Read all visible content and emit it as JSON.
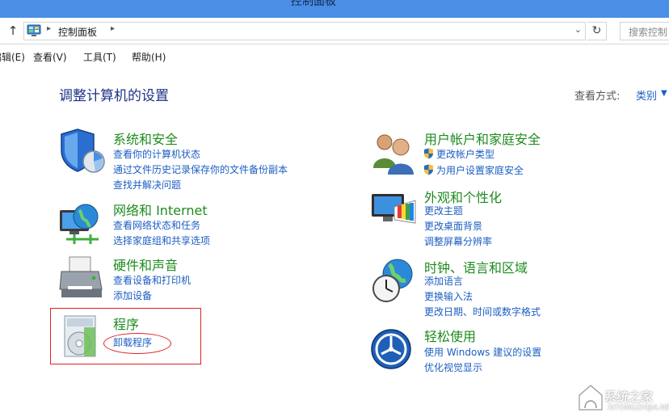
{
  "window": {
    "title": "控制面板"
  },
  "address": {
    "breadcrumb": "控制面板",
    "search_placeholder": "搜索控制"
  },
  "menu": [
    "编辑(E)",
    "查看(V)",
    "工具(T)",
    "帮助(H)"
  ],
  "main": {
    "heading": "调整计算机的设置",
    "view_by_label": "查看方式:",
    "view_by_value": "类别"
  },
  "categories": [
    {
      "title": "系统和安全",
      "icon": "shield-icon",
      "links": [
        "查看你的计算机状态",
        "通过文件历史记录保存你的文件备份副本",
        "查找并解决问题"
      ]
    },
    {
      "title": "网络和 Internet",
      "icon": "network-globe-icon",
      "links": [
        "查看网络状态和任务",
        "选择家庭组和共享选项"
      ]
    },
    {
      "title": "硬件和声音",
      "icon": "printer-icon",
      "links": [
        "查看设备和打印机",
        "添加设备"
      ]
    },
    {
      "title": "程序",
      "icon": "programs-disc-icon",
      "links": [
        "卸载程序"
      ]
    },
    {
      "title": "用户帐户和家庭安全",
      "icon": "users-icon",
      "links": [
        "更改帐户类型",
        "为用户设置家庭安全"
      ]
    },
    {
      "title": "外观和个性化",
      "icon": "display-palette-icon",
      "links": [
        "更改主题",
        "更改桌面背景",
        "调整屏幕分辨率"
      ]
    },
    {
      "title": "时钟、语言和区域",
      "icon": "clock-globe-icon",
      "links": [
        "添加语言",
        "更换输入法",
        "更改日期、时间或数字格式"
      ]
    },
    {
      "title": "轻松使用",
      "icon": "ease-of-access-icon",
      "links": [
        "使用 Windows 建议的设置",
        "优化视觉显示"
      ]
    }
  ],
  "watermark": {
    "text": "系统之家",
    "url": "XITONGZHIJIA.NET"
  },
  "colors": {
    "link": "#1c5ec2",
    "category_title": "#1e8b1e",
    "heading": "#1e3287",
    "annotation": "#e02020"
  }
}
